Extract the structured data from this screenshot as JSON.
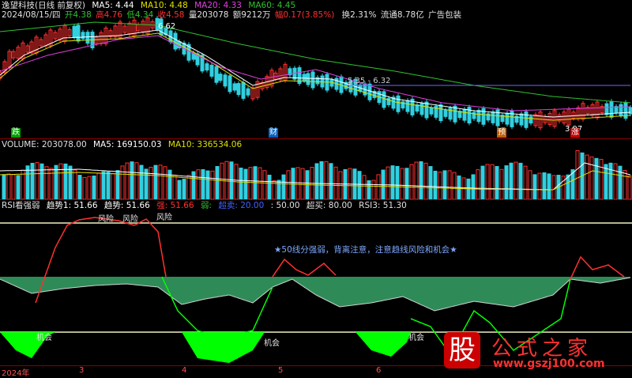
{
  "price_header": {
    "title": "逸望科技(日线 前复权)",
    "ma5": "MA5: 4.44",
    "ma10": "MA10: 4.48",
    "ma20": "MA20: 4.33",
    "ma60": "MA60: 4.45",
    "date": "2024/08/15/四",
    "open": "开4.38",
    "high": "高4.76",
    "low": "低4.34",
    "close": "收4.58",
    "volume": "量203078",
    "amount": "额9212万",
    "change": "幅0.17(3.85%)",
    "turnover": "换2.31%",
    "float": "流通8.78亿",
    "sector": "广告包装"
  },
  "price_annotations": {
    "high_mark": "6.62",
    "mid_mark": "5.35 - 6.32",
    "low_mark": "3.97",
    "tags": [
      "跌",
      "财",
      "预",
      "涨"
    ]
  },
  "volume_header": {
    "title": "VOLUME: 203078.00",
    "ma5": "MA5: 169150.03",
    "ma10": "MA10: 336534.06"
  },
  "rsi_header": {
    "title": "RSI看强弱",
    "trend1": "趋势1: 51.66",
    "trend": "趋势: 51.66",
    "strong": "强: 51.66",
    "weak": "弱:",
    "oversold": "超卖: 20.00",
    "mid": ": 50.00",
    "overbought": "超买: 80.00",
    "rsi3": "RSI3: 51.30"
  },
  "rsi_annotations": {
    "risk": [
      "风险",
      "风险",
      "风险"
    ],
    "chance": [
      "机会",
      "机会",
      "机会"
    ],
    "note": "★50线分强弱，背离注意，注意趋线风险和机会★"
  },
  "time_axis": [
    "2024年",
    "3",
    "4",
    "5",
    "6"
  ],
  "watermark": {
    "glyph": "股",
    "title": "公式之家",
    "url": "www.gszj100.com"
  },
  "colors": {
    "up": "#ff3030",
    "down": "#30d0e0",
    "ma5": "#ffffff",
    "ma10": "#e0e000",
    "ma20": "#e040e0",
    "ma60": "#30c030",
    "rsi_fill": "#2e8b57",
    "rsi_bright": "#00ff00"
  }
}
